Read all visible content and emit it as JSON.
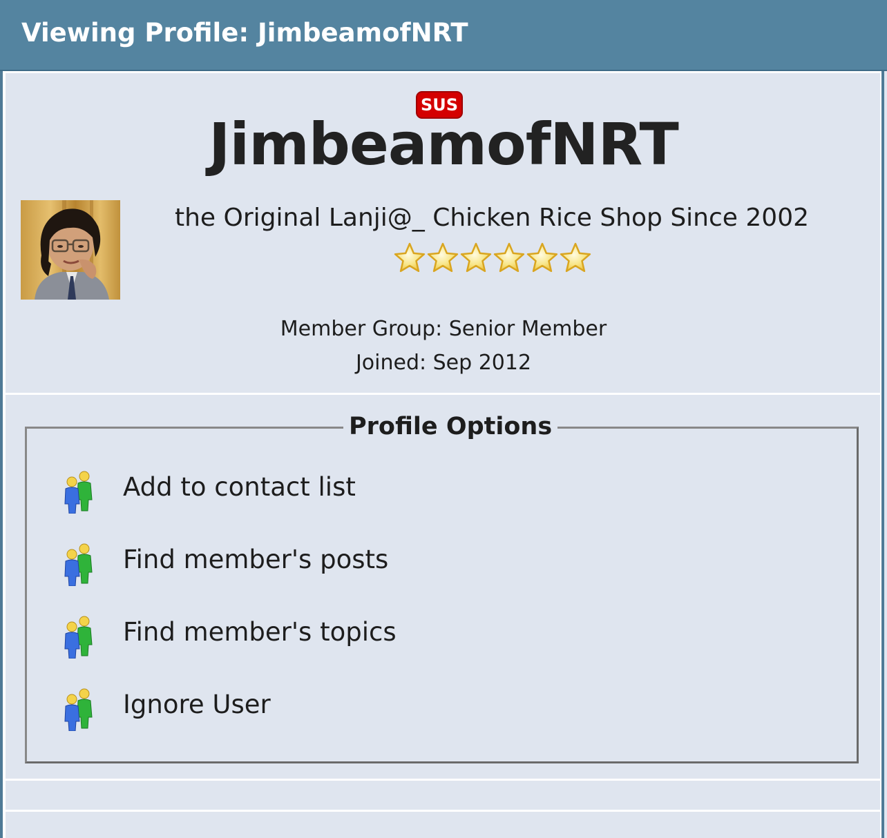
{
  "header": {
    "title": "Viewing Profile: JimbeamofNRT"
  },
  "profile": {
    "badge": "SUS",
    "username": "JimbeamofNRT",
    "tagline": "the Original Lanji@_ Chicken Rice Shop Since 2002",
    "stars": 6,
    "member_group": "Member Group: Senior Member",
    "joined": "Joined: Sep 2012"
  },
  "options": {
    "legend": "Profile Options",
    "items": [
      {
        "label": "Add to contact list",
        "icon": "users-icon"
      },
      {
        "label": "Find member's posts",
        "icon": "users-icon"
      },
      {
        "label": "Find member's topics",
        "icon": "users-icon"
      },
      {
        "label": "Ignore User",
        "icon": "users-icon"
      }
    ]
  },
  "colors": {
    "header_bg": "#5484a0",
    "panel_bg": "#dfe5ef",
    "badge_bg": "#d40000",
    "star_fill": "#f7e27a",
    "star_stroke": "#d9a520"
  }
}
